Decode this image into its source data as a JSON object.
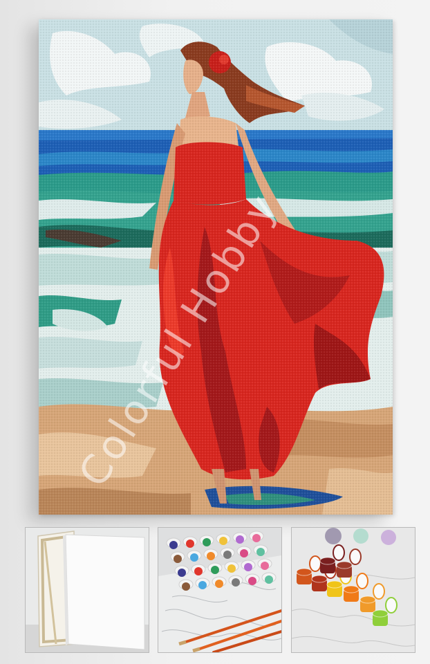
{
  "product": {
    "watermark_text": "Colorful Hobby",
    "watermark_color": "#ffffff"
  },
  "painting": {
    "subject_icon": "woman-red-dress-beach-painting",
    "colors": {
      "sky": "#cfe3e6",
      "sea_deep": "#1e62b8",
      "sea_green": "#2f9c86",
      "foam": "#e6efee",
      "sand": "#d8a779",
      "dress": "#d8261f",
      "dress_shadow": "#9e1616",
      "skin": "#e8b48c",
      "hair": "#8a3b1f"
    }
  },
  "thumbnails": [
    {
      "name": "blank-canvas-thumbnail",
      "icon": "stretched-canvas-icon"
    },
    {
      "name": "paint-pots-brushes-thumbnail",
      "icon": "paint-set-brushes-icon"
    },
    {
      "name": "open-paint-pots-thumbnail",
      "icon": "open-paint-pots-icon"
    }
  ]
}
